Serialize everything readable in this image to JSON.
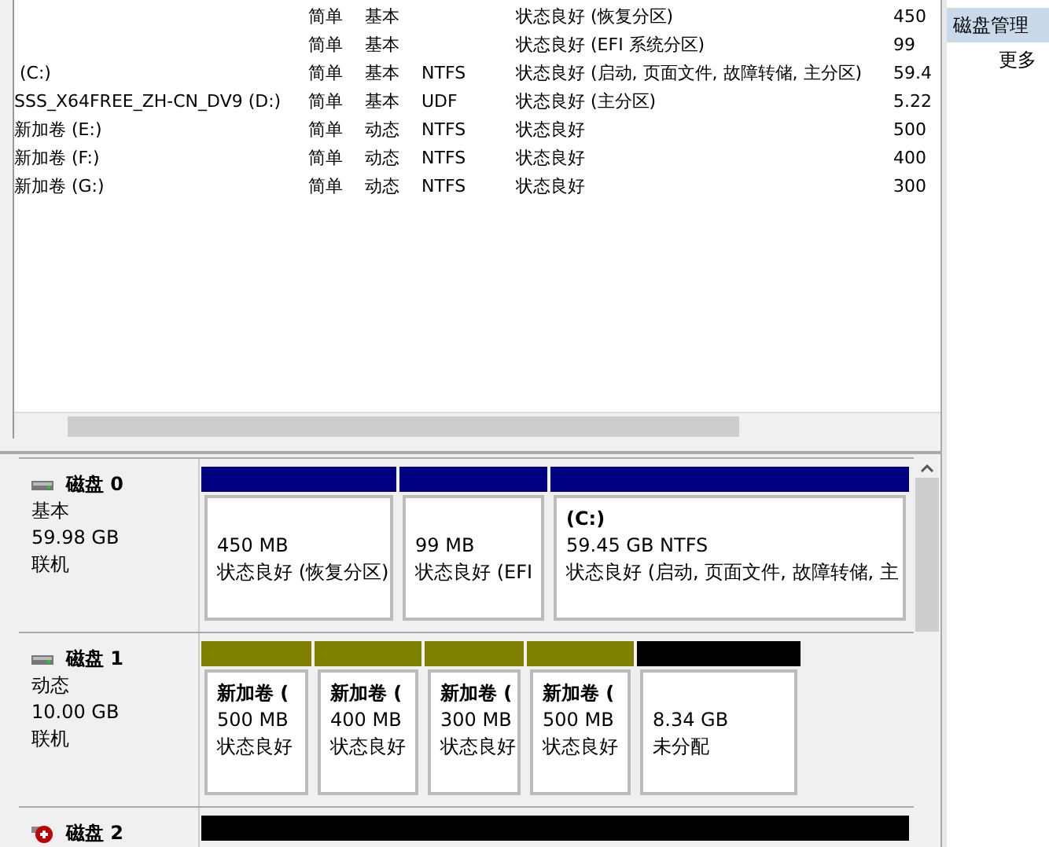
{
  "volume_list": {
    "rows": [
      {
        "layout": "简单",
        "type": "基本",
        "status": "状态良好 (恢复分区)",
        "capacity": "450"
      },
      {
        "layout": "简单",
        "type": "基本",
        "status": "状态良好 (EFI 系统分区)",
        "capacity": "99"
      },
      {
        "volume": " (C:)",
        "layout": "简单",
        "type": "基本",
        "file_system": "NTFS",
        "status": "状态良好 (启动, 页面文件, 故障转储, 主分区)",
        "capacity": "59.4"
      },
      {
        "volume": "SSS_X64FREE_ZH-CN_DV9 (D:)",
        "layout": "简单",
        "type": "基本",
        "file_system": "UDF",
        "status": "状态良好 (主分区)",
        "capacity": "5.22"
      },
      {
        "volume": "新加卷 (E:)",
        "layout": "简单",
        "type": "动态",
        "file_system": "NTFS",
        "status": "状态良好",
        "capacity": "500"
      },
      {
        "volume": "新加卷 (F:)",
        "layout": "简单",
        "type": "动态",
        "file_system": "NTFS",
        "status": "状态良好",
        "capacity": "400"
      },
      {
        "volume": "新加卷 (G:)",
        "layout": "简单",
        "type": "动态",
        "file_system": "NTFS",
        "status": "状态良好",
        "capacity": "300"
      }
    ]
  },
  "disks": [
    {
      "name": "磁盘 0",
      "type": "基本",
      "size": "59.98 GB",
      "status": "联机",
      "kind": "online",
      "partitions": [
        {
          "kind": "primary",
          "lines": [
            "450 MB",
            "状态良好 (恢复分区)"
          ]
        },
        {
          "kind": "primary",
          "lines": [
            "99 MB",
            "状态良好 (EFI"
          ]
        },
        {
          "kind": "primary",
          "title": "(C:)",
          "lines": [
            "59.45 GB NTFS",
            "状态良好 (启动, 页面文件, 故障转储, 主"
          ]
        }
      ]
    },
    {
      "name": "磁盘 1",
      "type": "动态",
      "size": "10.00 GB",
      "status": "联机",
      "kind": "online",
      "partitions": [
        {
          "kind": "simple",
          "title": "新加卷 (",
          "lines": [
            "500 MB",
            "状态良好"
          ]
        },
        {
          "kind": "simple",
          "title": "新加卷 (",
          "lines": [
            "400 MB",
            "状态良好"
          ]
        },
        {
          "kind": "simple",
          "title": "新加卷 (",
          "lines": [
            "300 MB",
            "状态良好"
          ]
        },
        {
          "kind": "simple",
          "title": "新加卷 (",
          "lines": [
            "500 MB",
            "状态良好"
          ]
        },
        {
          "kind": "unallocated",
          "lines": [
            "8.34 GB",
            "未分配"
          ]
        }
      ]
    },
    {
      "name": "磁盘 2",
      "kind": "error",
      "partitions": [
        {
          "kind": "unallocated"
        }
      ]
    }
  ],
  "actions": {
    "items": [
      {
        "label": "磁盘管理",
        "selected": true
      },
      {
        "label": "更多",
        "selected": false
      }
    ]
  }
}
